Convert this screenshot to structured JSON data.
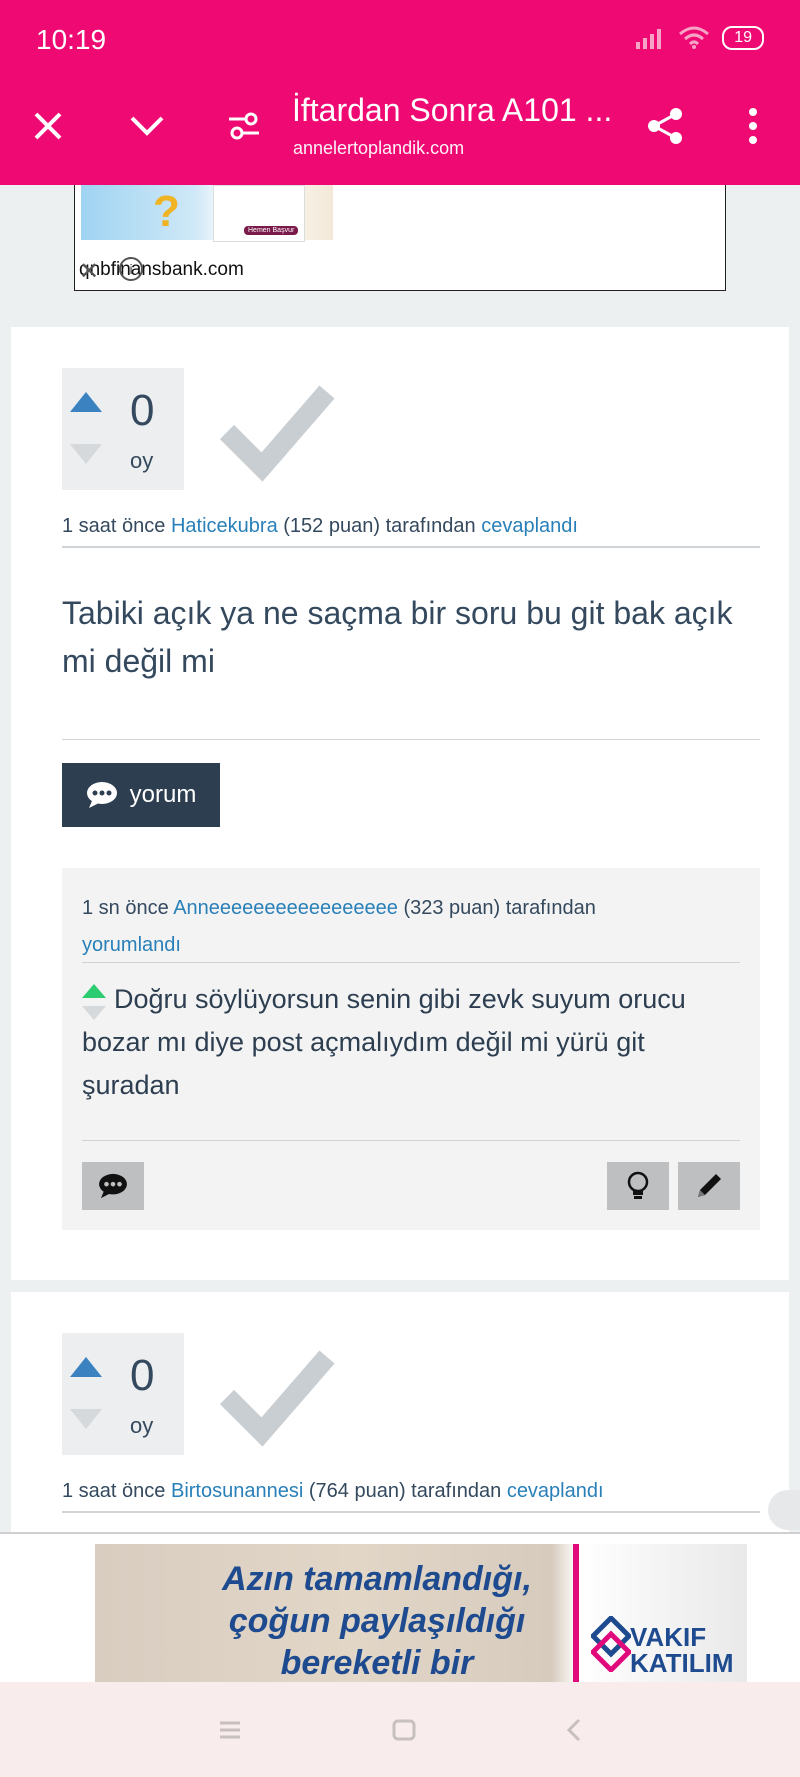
{
  "status_bar": {
    "time": "10:19",
    "battery": "19"
  },
  "browser": {
    "title": "İftardan Sonra A101 ...",
    "domain": "annelertoplandik.com",
    "accent": "#ef0a73"
  },
  "ad_top": {
    "text": "qnbfinansbank.com",
    "banner_text": "Hemen Başvur"
  },
  "answers": [
    {
      "votes": "0",
      "votes_label": "oy",
      "meta_prefix": "1 saat önce",
      "user": "Haticekubra",
      "points": "(152 puan)",
      "meta_mid": "tarafından",
      "action": "cevaplandı",
      "text": "Tabiki açık ya ne saçma bir soru bu git bak açık mi değil mi",
      "comment_button": "yorum",
      "comment": {
        "meta_prefix": "1 sn önce",
        "user": "Anneeeeeeeeeeeeeeeee",
        "points": "(323 puan)",
        "meta_mid": "tarafından",
        "action": "yorumlandı",
        "text": "Doğru söylüyorsun senin gibi zevk suyum orucu bozar mı diye post açmalıydım değil mi yürü git şuradan"
      }
    },
    {
      "votes": "0",
      "votes_label": "oy",
      "meta_prefix": "1 saat önce",
      "user": "Birtosunannesi",
      "points": "(764 puan)",
      "meta_mid": "tarafından",
      "action": "cevaplandı"
    }
  ],
  "ad_bottom": {
    "lines": [
      "Azın tamamlandığı,",
      "çoğun paylaşıldığı",
      "bereketli bir"
    ],
    "brand_line1": "VAKIF",
    "brand_line2": "KATILIM"
  },
  "icons": {
    "close": "close-icon",
    "chevron": "chevron-down-icon",
    "tune": "tune-icon",
    "share": "share-icon",
    "more": "more-vert-icon",
    "check": "accepted-check-icon",
    "comment": "comment-icon",
    "bulb": "lightbulb-icon",
    "edit": "pencil-icon"
  }
}
